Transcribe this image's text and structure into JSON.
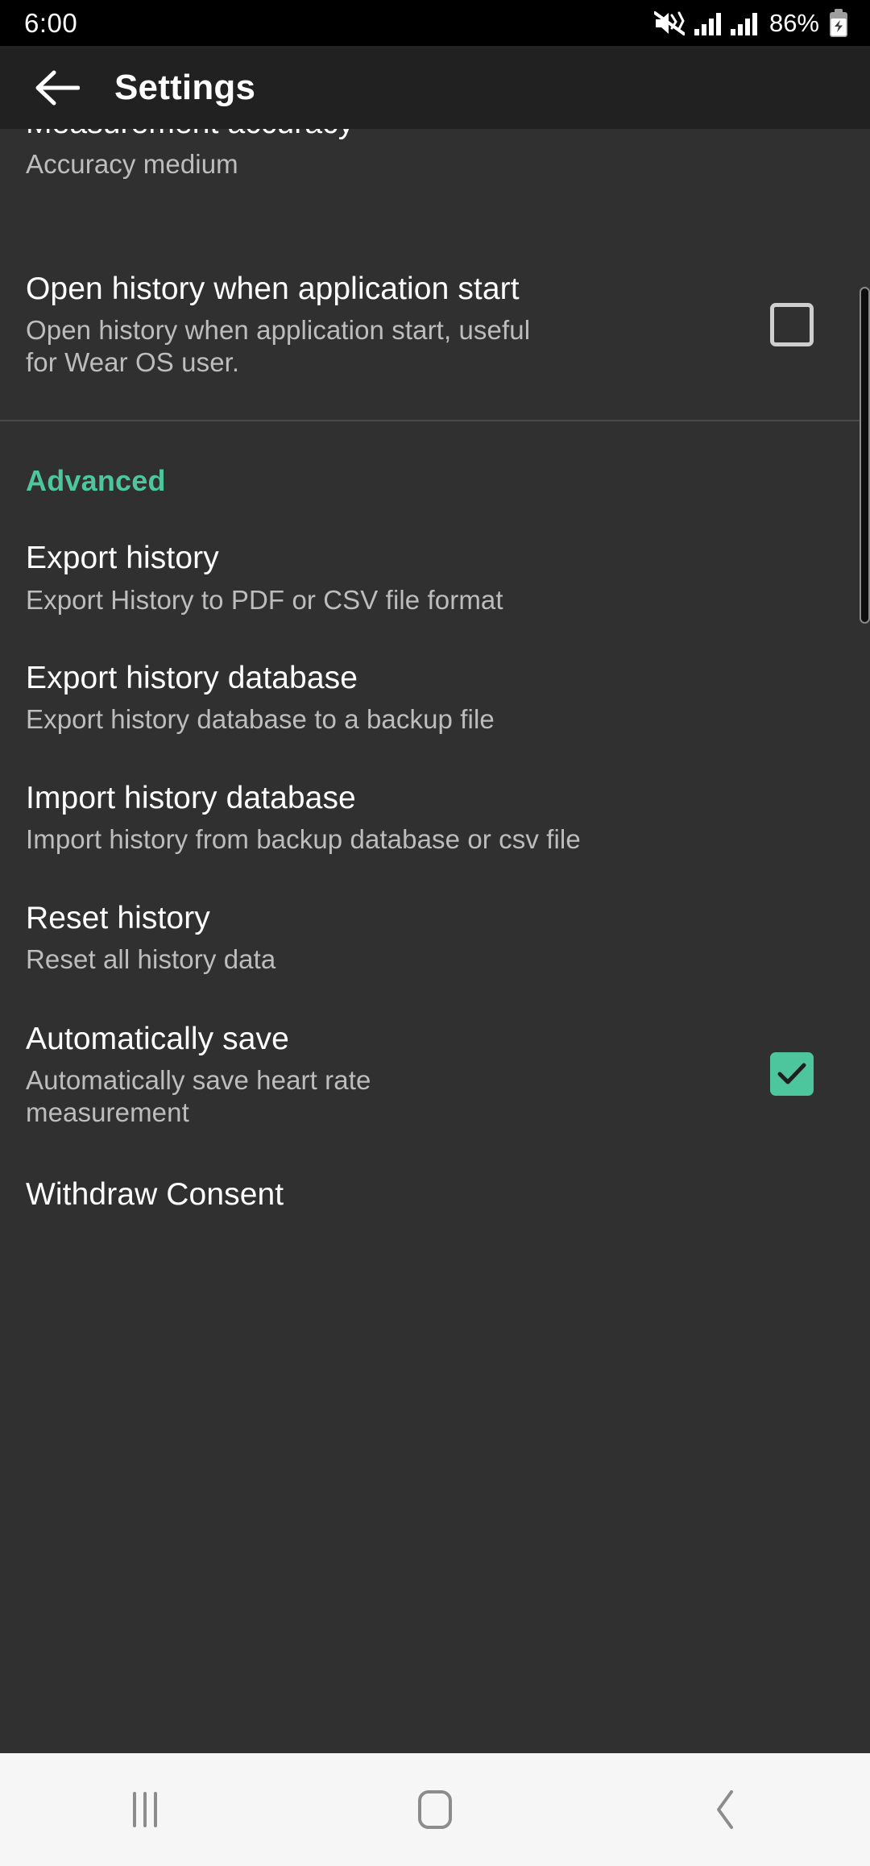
{
  "status_bar": {
    "time": "6:00",
    "battery_percent": "86%",
    "icons": [
      "mute-icon",
      "signal-bars-icon",
      "signal-bars-icon",
      "battery-charging-icon"
    ]
  },
  "app_bar": {
    "back_label": "back-arrow",
    "title": "Settings"
  },
  "colors": {
    "accent": "#4ec69d",
    "background": "#303030",
    "app_bar": "#212121",
    "status_bar": "#000000",
    "nav_bar": "#f6f6f6",
    "title_text": "#ffffff",
    "summary_text": "#bdbdbd"
  },
  "preferences": {
    "partial_top": {
      "title": "Measurement accuracy",
      "summary": "Accuracy medium"
    },
    "open_history": {
      "title": "Open history when application start",
      "summary": "Open history when application start, useful for Wear OS user.",
      "checked": false
    }
  },
  "advanced_section": {
    "header": "Advanced",
    "items": [
      {
        "title": "Export history",
        "summary": "Export History to PDF or CSV file format",
        "has_checkbox": false
      },
      {
        "title": "Export history database",
        "summary": "Export history database to a backup file",
        "has_checkbox": false
      },
      {
        "title": "Import history database",
        "summary": "Import history from backup database or csv file",
        "has_checkbox": false
      },
      {
        "title": "Reset history",
        "summary": "Reset all history data",
        "has_checkbox": false
      },
      {
        "title": "Automatically save",
        "summary": "Automatically save heart rate measurement",
        "has_checkbox": true,
        "checked": true
      },
      {
        "title": "Withdraw Consent",
        "summary": "",
        "has_checkbox": false
      }
    ]
  },
  "nav_bar": {
    "recents_label": "recents-icon",
    "home_label": "home-icon",
    "back_label": "back-icon"
  }
}
